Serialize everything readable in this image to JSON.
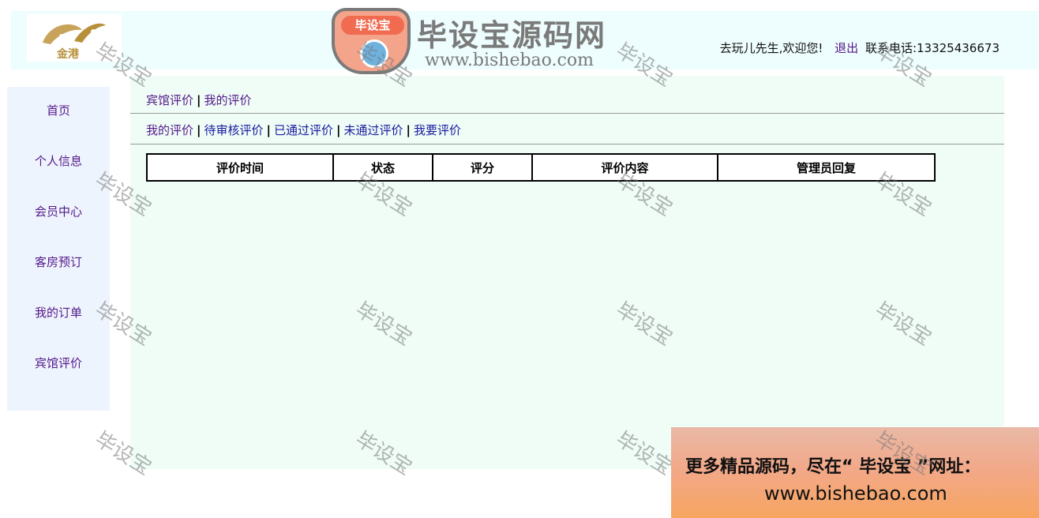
{
  "header": {
    "logo_text": "金港",
    "greeting": "去玩儿先生,欢迎您!",
    "logout": "退出",
    "contact": "联系电话:13325436673"
  },
  "sidebar": {
    "items": [
      {
        "label": "首页"
      },
      {
        "label": "个人信息"
      },
      {
        "label": "会员中心"
      },
      {
        "label": "客房预订"
      },
      {
        "label": "我的订单"
      },
      {
        "label": "宾馆评价"
      }
    ]
  },
  "breadcrumb": {
    "items": [
      "宾馆评价",
      "我的评价"
    ]
  },
  "tabs": [
    "我的评价",
    "待审核评价",
    "已通过评价",
    "未通过评价",
    "我要评价"
  ],
  "table": {
    "columns": [
      "评价时间",
      "状态",
      "评分",
      "评价内容",
      "管理员回复"
    ],
    "rows": []
  },
  "watermark": {
    "badge": "毕设宝",
    "title": "毕设宝源码网",
    "url": "www.bishebao.com",
    "tile": "毕设宝"
  },
  "promo": {
    "line1": "更多精品源码，尽在“ 毕设宝 ”网址：",
    "line2": "www.bishebao.com"
  },
  "colors": {
    "header_bg": "#eefdfd",
    "sidebar_bg": "#eef4fd",
    "main_bg": "#effdf6",
    "link": "#551a8b",
    "tab_link": "#1a1aa0"
  }
}
